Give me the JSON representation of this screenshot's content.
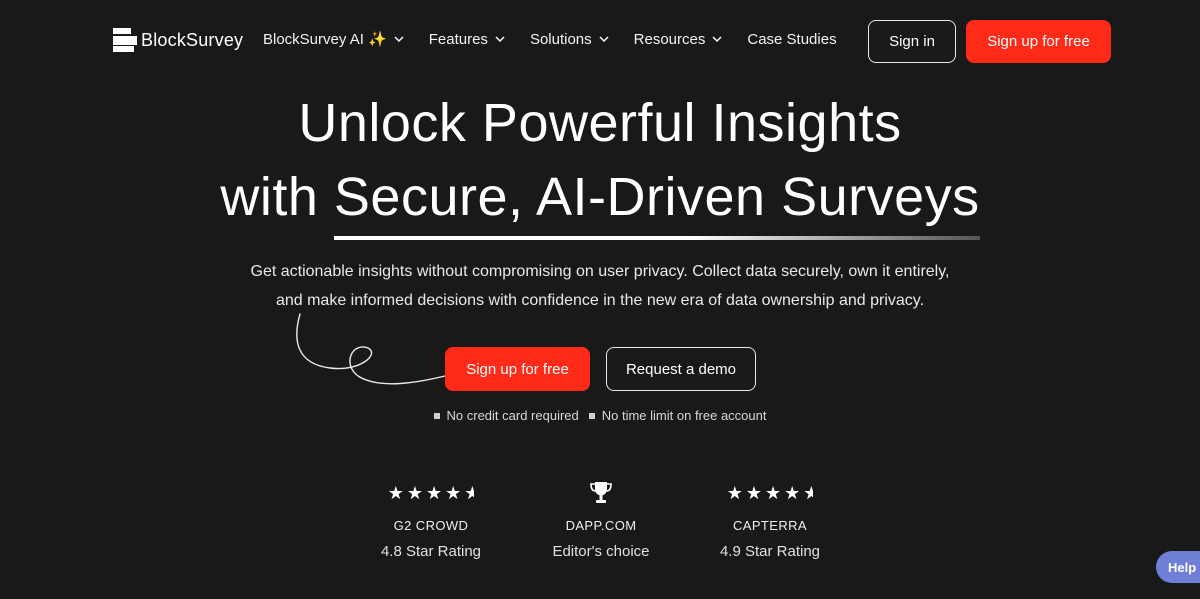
{
  "brand": {
    "name": "BlockSurvey"
  },
  "nav": {
    "items": [
      {
        "label": "BlockSurvey AI ✨",
        "has_dropdown": true
      },
      {
        "label": "Features",
        "has_dropdown": true
      },
      {
        "label": "Solutions",
        "has_dropdown": true
      },
      {
        "label": "Resources",
        "has_dropdown": true
      },
      {
        "label": "Case Studies",
        "has_dropdown": false
      }
    ],
    "signin_label": "Sign in",
    "signup_label": "Sign up for free"
  },
  "hero": {
    "title_line1": "Unlock Powerful Insights",
    "title_line2_prefix": "with ",
    "title_line2_highlight": "Secure, AI-Driven Surveys",
    "subtitle_line1": "Get actionable insights without compromising on user privacy. Collect data securely, own it entirely,",
    "subtitle_line2": "and make informed decisions with confidence in the new era of data ownership and privacy.",
    "cta_primary": "Sign up for free",
    "cta_secondary": "Request a demo",
    "notes": [
      "No credit card required",
      "No time limit on free account"
    ]
  },
  "ratings": [
    {
      "icon": "stars-icon",
      "stars": 4.5,
      "name": "G2 CROWD",
      "label": "4.8 Star Rating"
    },
    {
      "icon": "trophy-icon",
      "name": "DAPP.COM",
      "label": "Editor's choice"
    },
    {
      "icon": "stars-icon",
      "stars": 4.5,
      "name": "CAPTERRA",
      "label": "4.9 Star Rating"
    }
  ],
  "help": {
    "label": "Help"
  },
  "colors": {
    "background": "#191919",
    "accent": "#ff2a18",
    "help": "#6f7fd6"
  }
}
